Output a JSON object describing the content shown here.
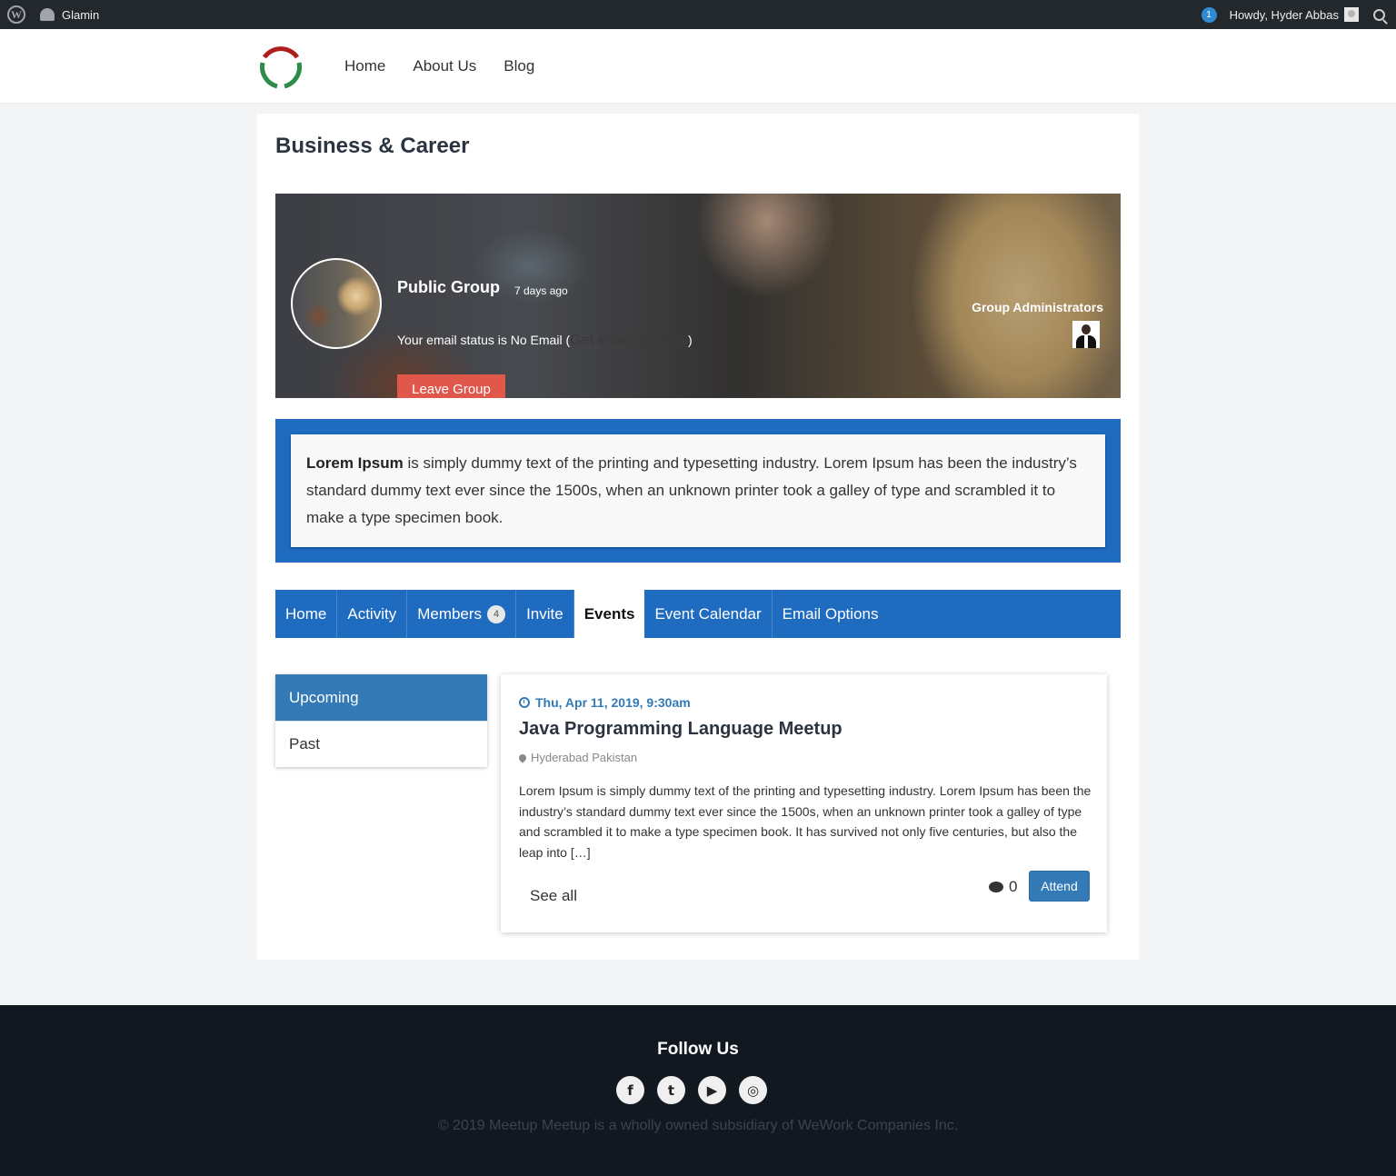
{
  "adminbar": {
    "site_name": "Glamin",
    "notification_count": "1",
    "howdy": "Howdy, Hyder Abbas",
    "wp_icon": "wordpress-icon",
    "dashboard_icon": "dashboard-icon",
    "search_icon": "search-icon"
  },
  "nav": {
    "items": [
      {
        "label": "Home"
      },
      {
        "label": "About Us"
      },
      {
        "label": "Blog"
      }
    ]
  },
  "page": {
    "title": "Business & Career"
  },
  "group": {
    "type": "Public Group",
    "active_ago": "7 days ago",
    "email_status_text": "Your email status is No Email (",
    "email_link": "Get email updates",
    "email_status_close": ")",
    "leave_button": "Leave Group",
    "admins_label": "Group Administrators",
    "description_bold": "Lorem Ipsum",
    "description_rest": " is simply dummy text of the printing and typesetting industry. Lorem Ipsum has been the industry’s standard dummy text ever since the 1500s, when an unknown printer took a galley of type and scrambled it to make a type specimen book."
  },
  "tabs": [
    {
      "label": "Home"
    },
    {
      "label": "Activity"
    },
    {
      "label": "Members",
      "count": "4"
    },
    {
      "label": "Invite"
    },
    {
      "label": "Events",
      "active": true
    },
    {
      "label": "Event Calendar"
    },
    {
      "label": "Email Options"
    }
  ],
  "events_filter": {
    "upcoming": "Upcoming",
    "past": "Past"
  },
  "event": {
    "date": "Thu, Apr 11, 2019, 9:30am",
    "title": "Java Programming Language Meetup",
    "location": "Hyderabad Pakistan",
    "excerpt": "Lorem Ipsum is simply dummy text of the printing and typesetting industry. Lorem Ipsum has been the industry’s standard dummy text ever since the 1500s, when an unknown printer took a galley of type and scrambled it to make a type specimen book. It has survived not only five centuries, but also the leap into […]",
    "see_all": "See all",
    "comment_count": "0",
    "attend_button": "Attend"
  },
  "footer": {
    "follow_title": "Follow Us",
    "social": [
      {
        "icon": "facebook-icon",
        "glyph": "f"
      },
      {
        "icon": "twitter-icon",
        "glyph": "t"
      },
      {
        "icon": "youtube-icon",
        "glyph": "▶"
      },
      {
        "icon": "instagram-icon",
        "glyph": "◎"
      }
    ],
    "copyright": "© 2019 Meetup Meetup is a wholly owned subsidiary of WeWork Companies Inc."
  },
  "colors": {
    "primary_blue": "#1e6bc0",
    "button_blue": "#337ab7",
    "leave_red": "#e0574c",
    "adminbar": "#23282d",
    "footer": "#111820"
  }
}
